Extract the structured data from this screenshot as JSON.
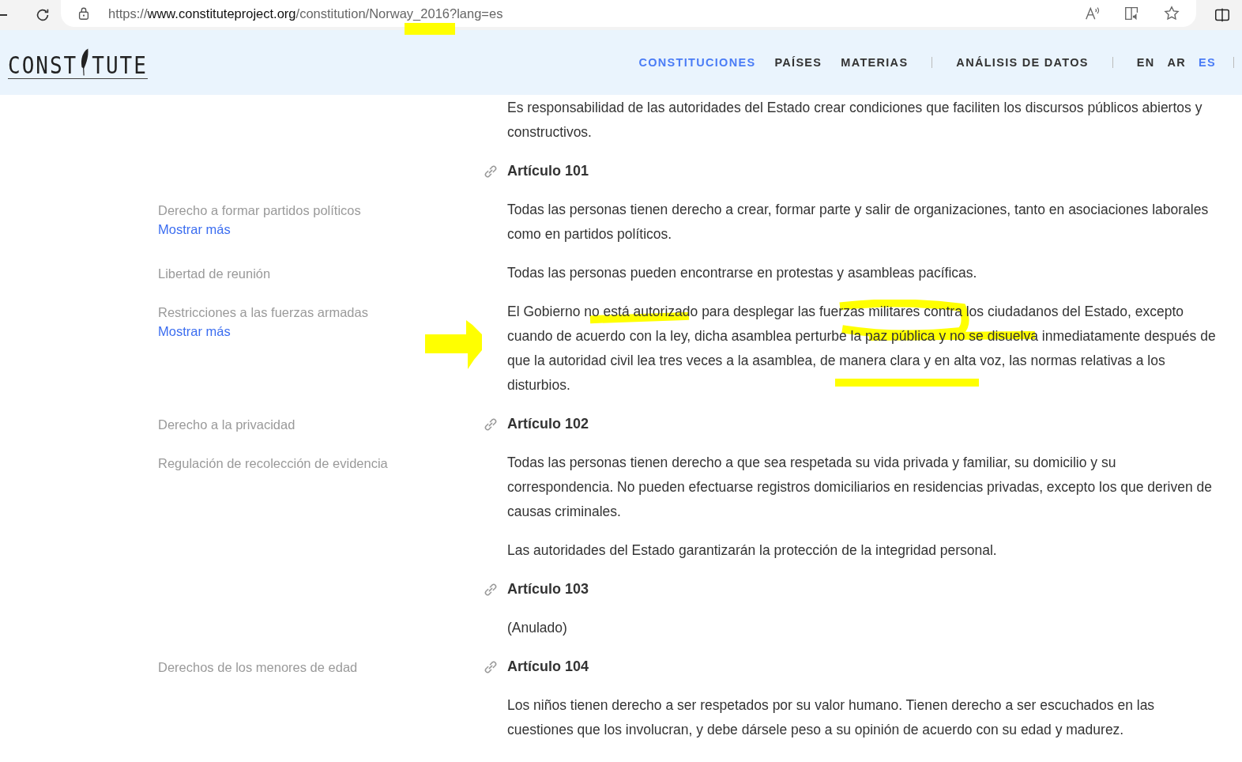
{
  "browser": {
    "url_scheme": "https://",
    "url_host": "www.constituteproject.org",
    "url_path": "/constitution/Norway_2016?lang=es"
  },
  "logo": {
    "before": "CONST",
    "after": "TUTE"
  },
  "nav": [
    {
      "label": "CONSTITUCIONES",
      "selected": true
    },
    {
      "label": "PAÍSES",
      "selected": false
    },
    {
      "label": "MATERIAS",
      "selected": false
    },
    {
      "label": "ANÁLISIS DE DATOS",
      "selected": false
    }
  ],
  "languages": [
    {
      "label": "EN",
      "selected": false
    },
    {
      "label": "AR",
      "selected": false
    },
    {
      "label": "ES",
      "selected": true
    }
  ],
  "rows": [
    {
      "kind": "paragraph",
      "annotated": false,
      "text": "Es responsabilidad de las autoridades del Estado crear condiciones que faciliten los discursos públicos abiertos y constructivos."
    },
    {
      "kind": "heading",
      "text": "Artículo 101"
    },
    {
      "kind": "paragraph",
      "annotated": false,
      "text": "Todas las personas tienen derecho a crear, formar parte y salir de organizaciones, tanto en asociaciones laborales como en partidos políticos.",
      "topic": {
        "label": "Derecho a formar partidos políticos",
        "more": "Mostrar más"
      }
    },
    {
      "kind": "paragraph",
      "annotated": false,
      "text": "Todas las personas pueden encontrarse en protestas y asambleas pacíficas.",
      "topic": {
        "label": "Libertad de reunión"
      }
    },
    {
      "kind": "paragraph",
      "annotated": true,
      "text": "El Gobierno no está autorizado para desplegar las fuerzas militares contra los ciudadanos del Estado, excepto cuando de acuerdo con la ley, dicha asamblea perturbe la paz pública y no se disuelva inmediatamente después de que la autoridad civil lea tres veces a la asamblea, de manera clara y en alta voz, las normas relativas a los disturbios.",
      "topic": {
        "label": "Restricciones a las fuerzas armadas",
        "more": "Mostrar más"
      }
    },
    {
      "kind": "heading",
      "text": "Artículo 102",
      "topic": {
        "label": "Derecho a la privacidad"
      }
    },
    {
      "kind": "paragraph",
      "annotated": false,
      "text": "Todas las personas tienen derecho a que sea respetada su vida privada y familiar, su domicilio y su correspondencia. No pueden efectuarse registros domiciliarios en residencias privadas, excepto los que deriven de causas criminales.",
      "topic": {
        "label": "Regulación de recolección de evidencia"
      }
    },
    {
      "kind": "paragraph",
      "annotated": false,
      "text": "Las autoridades del Estado garantizarán la protección de la integridad personal."
    },
    {
      "kind": "heading",
      "text": "Artículo 103"
    },
    {
      "kind": "paragraph",
      "annotated": false,
      "text": "(Anulado)"
    },
    {
      "kind": "heading",
      "text": "Artículo 104",
      "topic": {
        "label": "Derechos de los menores de edad"
      }
    },
    {
      "kind": "paragraph",
      "annotated": false,
      "text": "Los niños tienen derecho a ser respetados por su valor humano. Tienen derecho a ser escuchados en las cuestiones que los involucran, y debe dársele peso a su opinión de acuerdo con su edad y madurez."
    }
  ]
}
